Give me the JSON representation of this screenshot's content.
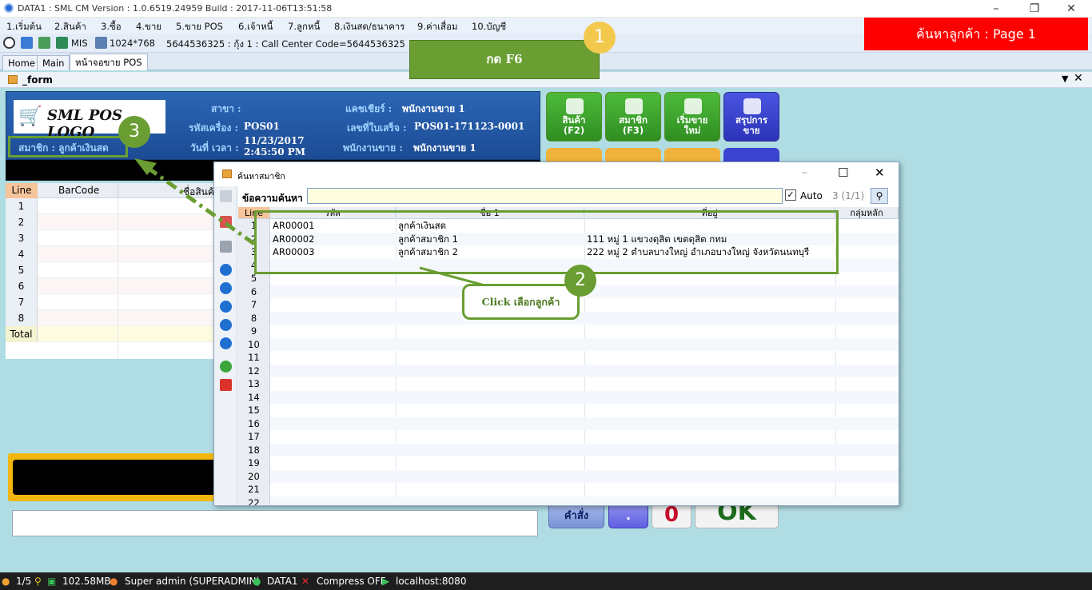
{
  "window": {
    "title": "DATA1 : SML CM Version : 1.0.6519.24959  Build : 2017-11-06T13:51:58"
  },
  "menu": [
    "1.เริ่มต้น",
    "2.สินค้า",
    "3.ซื้อ",
    "4.ขาย",
    "5.ขาย POS",
    "6.เจ้าหนี้",
    "7.ลูกหนี้",
    "8.เงินสด/ธนาคาร",
    "9.ค่าเสื่อม",
    "10.บัญชี"
  ],
  "toolbar": {
    "mis": "MIS",
    "resolution": "1024*768",
    "info": "5644536325 : กุ้ง 1 : Call Center Code=5644536325"
  },
  "tabs": [
    "Home",
    "Main",
    "หน้าจอขาย POS"
  ],
  "form_title": "_form",
  "pos_header": {
    "logo": "SML POS LOGO",
    "branch_label": "สาขา :",
    "machine_label": "รหัสเครื่อง :",
    "machine_value": "POS01",
    "datetime_label": "วันที่ เวลา :",
    "date_value": "11/23/2017",
    "time_value": "2:45:50 PM",
    "cashier_label": "แคชเชียร์ :",
    "cashier_value": "พนักงานขาย 1",
    "receipt_label": "เลขที่ใบเสร็จ :",
    "receipt_value": "POS01-171123-0001",
    "sales_label": "พนักงานขาย :",
    "sales_value": "พนักงานขาย 1",
    "member_text": "สมาชิก : ลูกค้าเงินสด"
  },
  "left_grid": {
    "col_line": "Line",
    "col_barcode": "BarCode",
    "col_name": "ชื่อสินค้า",
    "rows": [
      "1",
      "2",
      "3",
      "4",
      "5",
      "6",
      "7",
      "8"
    ],
    "total": "Total"
  },
  "buttons": [
    {
      "label1": "สินค้า",
      "label2": "(F2)"
    },
    {
      "label1": "สมาชิก",
      "label2": "(F3)"
    },
    {
      "label1": "เริ่มขาย",
      "label2": "ใหม่"
    },
    {
      "label1": "สรุปการ",
      "label2": "ขาย"
    }
  ],
  "bottom_buttons": {
    "command": "คำสั่ง",
    "dot": ".",
    "zero": "0",
    "ok": "OK"
  },
  "dialog": {
    "title": "ค้นหาสมาชิก",
    "search_label": "ข้อความค้นหา",
    "search_value": "",
    "auto_label": "Auto",
    "page_info": "3 (1/1)",
    "columns": [
      "Line",
      "รหัส",
      "ชื่อ 1",
      "ที่อยู่",
      "กลุ่มหลัก"
    ],
    "rows": [
      {
        "line": "1",
        "code": "AR00001",
        "name": "ลูกค้าเงินสด",
        "address": ""
      },
      {
        "line": "2",
        "code": "AR00002",
        "name": "ลูกค้าสมาชิก 1",
        "address": "111 หมู่ 1 แขวงดุสิต เขตดุสิต กทม"
      },
      {
        "line": "3",
        "code": "AR00003",
        "name": "ลูกค้าสมาชิก 2",
        "address": "222 หมู่ 2 ตำบลบางใหญ่ อำเภอบางใหญ่ จังหวัดนนทบุรี"
      },
      {
        "line": "4",
        "code": "",
        "name": "",
        "address": ""
      },
      {
        "line": "5",
        "code": "",
        "name": "",
        "address": ""
      },
      {
        "line": "6",
        "code": "",
        "name": "",
        "address": ""
      },
      {
        "line": "7",
        "code": "",
        "name": "",
        "address": ""
      },
      {
        "line": "8",
        "code": "",
        "name": "",
        "address": ""
      },
      {
        "line": "9",
        "code": "",
        "name": "",
        "address": ""
      },
      {
        "line": "10",
        "code": "",
        "name": "",
        "address": ""
      },
      {
        "line": "11",
        "code": "",
        "name": "",
        "address": ""
      },
      {
        "line": "12",
        "code": "",
        "name": "",
        "address": ""
      },
      {
        "line": "13",
        "code": "",
        "name": "",
        "address": ""
      },
      {
        "line": "14",
        "code": "",
        "name": "",
        "address": ""
      },
      {
        "line": "15",
        "code": "",
        "name": "",
        "address": ""
      },
      {
        "line": "16",
        "code": "",
        "name": "",
        "address": ""
      },
      {
        "line": "17",
        "code": "",
        "name": "",
        "address": ""
      },
      {
        "line": "18",
        "code": "",
        "name": "",
        "address": ""
      },
      {
        "line": "19",
        "code": "",
        "name": "",
        "address": ""
      },
      {
        "line": "20",
        "code": "",
        "name": "",
        "address": ""
      },
      {
        "line": "21",
        "code": "",
        "name": "",
        "address": ""
      },
      {
        "line": "22",
        "code": "",
        "name": "",
        "address": ""
      }
    ]
  },
  "statusbar": {
    "page": "1/5",
    "memory": "102.58MB",
    "user": "Super admin (SUPERADMIN)",
    "db": "DATA1",
    "compress": "Compress OFF",
    "server": "localhost:8080"
  },
  "annotations": {
    "f6": "กด F6",
    "search_customer": "ค้นหาลูกค้า : Page 1",
    "callout": "Click เลือกลูกค้า",
    "step1": "1",
    "step2": "2",
    "step3": "3"
  },
  "colors": {
    "accent_green": "#6a9e32",
    "red": "#ff0000",
    "pos_blue": "#2c66b5",
    "annotation_circle": "#6a9e32",
    "step1_circle": "#f2c94c"
  }
}
